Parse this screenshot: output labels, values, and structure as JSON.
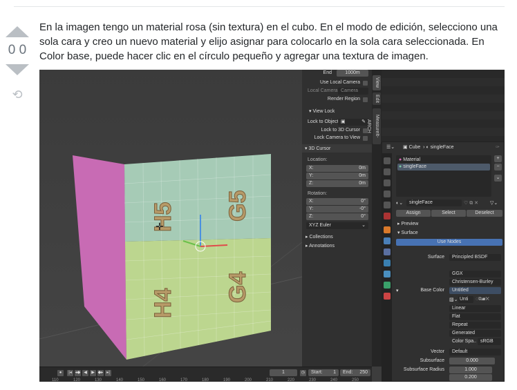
{
  "vote": {
    "count": "0 0"
  },
  "post": {
    "text": "En la imagen tengo un material rosa (sin textura) en el cubo. En el modo de edición, selecciono una sola cara y creo un nuevo material y elijo asignar para colocarlo en la sola cara seleccionada. En Color base, puede hacer clic en el círculo pequeño y agregar una textura de imagen."
  },
  "blender": {
    "npanel": {
      "end_label": "End",
      "end_value": "1000m",
      "use_local_camera": "Use Local Camera",
      "local_camera": "Local Camera",
      "camera": "Camera",
      "render_region": "Render Region",
      "view_lock": "View Lock",
      "lock_to_object": "Lock to Object",
      "lock_3d_cursor": "Lock to 3D Cursor",
      "lock_camera_view": "Lock Camera to View",
      "cursor_header": "3D Cursor",
      "location": "Location:",
      "rotation": "Rotation:",
      "loc": [
        {
          "axis": "X:",
          "value": "0m"
        },
        {
          "axis": "Y:",
          "value": "0m"
        },
        {
          "axis": "Z:",
          "value": "0m"
        }
      ],
      "rot": [
        {
          "axis": "X:",
          "value": "0°"
        },
        {
          "axis": "Y:",
          "value": "-0°"
        },
        {
          "axis": "Z:",
          "value": "0°"
        }
      ],
      "euler": "XYZ Euler",
      "collections": "Collections",
      "annotations": "Annotations"
    },
    "tabs": [
      "View",
      "Edit",
      "MeasureIt-ARCH"
    ],
    "props": {
      "object": "Cube",
      "material": "singleFace",
      "slots": [
        "Material",
        "singleFace"
      ],
      "mat_name": "singleFace",
      "assign": "Assign",
      "select": "Select",
      "deselect": "Deselect",
      "preview": "Preview",
      "surface_header": "Surface",
      "use_nodes": "Use Nodes",
      "surface_label": "Surface",
      "surface_value": "Principled BSDF",
      "distribution": "GGX",
      "subsurface_method": "Christensen-Burley",
      "base_color_label": "Base Color",
      "base_color_value": "Untitled",
      "image_name": "Unti",
      "interp": "Linear",
      "projection": "Flat",
      "extension": "Repeat",
      "source": "Generated",
      "color_space_label": "Color Spa..",
      "color_space": "sRGB",
      "vector_label": "Vector",
      "vector_value": "Default",
      "subsurface_label": "Subsurface",
      "subsurface_value": "0.000",
      "ss_radius_label": "Subsurface Radius",
      "ss_radius": [
        "1.000",
        "0.200"
      ]
    },
    "cube_labels": [
      "H5",
      "G5",
      "H4",
      "G4"
    ],
    "timeline": {
      "frame": "1",
      "start_label": "Start:",
      "start": "1",
      "end_label": "End:",
      "end": "250",
      "ticks": [
        "110",
        "120",
        "130",
        "140",
        "150",
        "160",
        "170",
        "180",
        "190",
        "200",
        "210",
        "220",
        "230",
        "240",
        "250"
      ]
    }
  }
}
